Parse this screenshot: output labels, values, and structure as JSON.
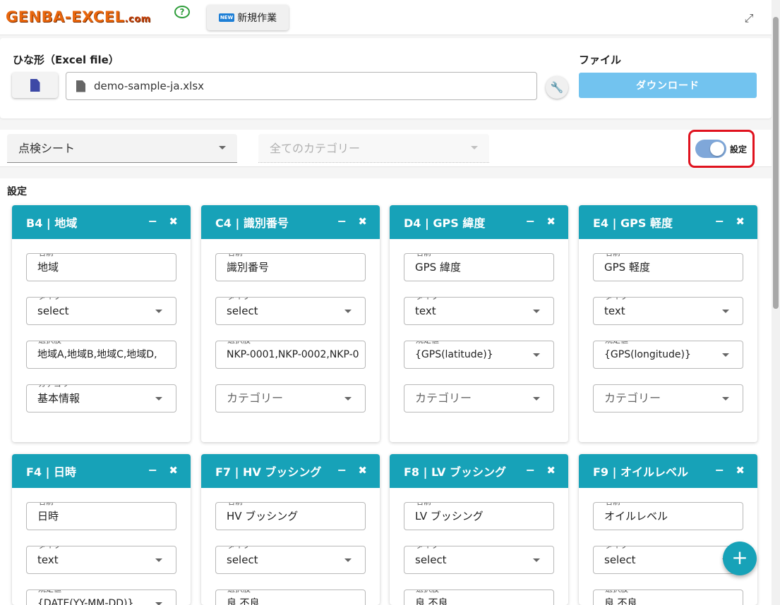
{
  "header": {
    "logo_text": "GENBA-EXCEL",
    "logo_suffix": ".com",
    "help_glyph": "?",
    "new_badge": "NEW",
    "new_button": "新規作業"
  },
  "file_panel": {
    "template_label": "ひな形（Excel file）",
    "file_name": "demo-sample-ja.xlsx",
    "file_section_label": "ファイル",
    "download_button": "ダウンロード"
  },
  "filters": {
    "sheet_select": "点検シート",
    "category_placeholder": "全てのカテゴリー",
    "toggle_label": "設定",
    "toggle_on": true
  },
  "settings": {
    "title": "設定",
    "cards": [
      {
        "title": "B4 | 地域",
        "name_label": "名前",
        "name": "地域",
        "type_label": "タイプ",
        "type": "select",
        "third_label": "選択肢",
        "third": "地域A,地域B,地域C,地域D,",
        "third_select": false,
        "category_label": "カテゴリー",
        "category": "基本情報",
        "category_empty": ""
      },
      {
        "title": "C4 | 識別番号",
        "name_label": "名前",
        "name": "識別番号",
        "type_label": "タイプ",
        "type": "select",
        "third_label": "選択肢",
        "third": "NKP-0001,NKP-0002,NKP-0",
        "third_select": false,
        "category_label": "",
        "category": "",
        "category_empty": "カテゴリー"
      },
      {
        "title": "D4 | GPS 緯度",
        "name_label": "名前",
        "name": "GPS 緯度",
        "type_label": "タイプ",
        "type": "text",
        "third_label": "規定値",
        "third": "{GPS(latitude)}",
        "third_select": true,
        "category_label": "",
        "category": "",
        "category_empty": "カテゴリー"
      },
      {
        "title": "E4 | GPS 軽度",
        "name_label": "名前",
        "name": "GPS 軽度",
        "type_label": "タイプ",
        "type": "text",
        "third_label": "規定値",
        "third": "{GPS(longitude)}",
        "third_select": true,
        "category_label": "",
        "category": "",
        "category_empty": "カテゴリー"
      },
      {
        "title": "F4 | 日時",
        "name_label": "名前",
        "name": "日時",
        "type_label": "タイプ",
        "type": "text",
        "third_label": "規定値",
        "third": "{DATE(YY-MM-DD)}",
        "third_select": true
      },
      {
        "title": "F7 | HV ブッシング",
        "name_label": "名前",
        "name": "HV ブッシング",
        "type_label": "タイプ",
        "type": "select",
        "third_label": "選択肢",
        "third": "良,不良",
        "third_select": false
      },
      {
        "title": "F8 | LV ブッシング",
        "name_label": "名前",
        "name": "LV ブッシング",
        "type_label": "タイプ",
        "type": "select",
        "third_label": "選択肢",
        "third": "良,不良",
        "third_select": false
      },
      {
        "title": "F9 | オイルレベル",
        "name_label": "名前",
        "name": "オイルレベル",
        "type_label": "タイプ",
        "type": "select",
        "third_label": "選択肢",
        "third": "良,不良",
        "third_select": false
      }
    ]
  },
  "fab_label": "+",
  "icons": {
    "expand": "expand-icon",
    "swap_file": "swap-file-icon",
    "file": "file-icon",
    "wrench": "wrench-icon",
    "minimize": "minimize-icon",
    "close": "close-icon",
    "add": "add-icon"
  },
  "colors": {
    "accent": "#17a2b8",
    "download": "#72c3ef",
    "toggle": "#7fa7d9",
    "highlight": "#e0121e"
  }
}
